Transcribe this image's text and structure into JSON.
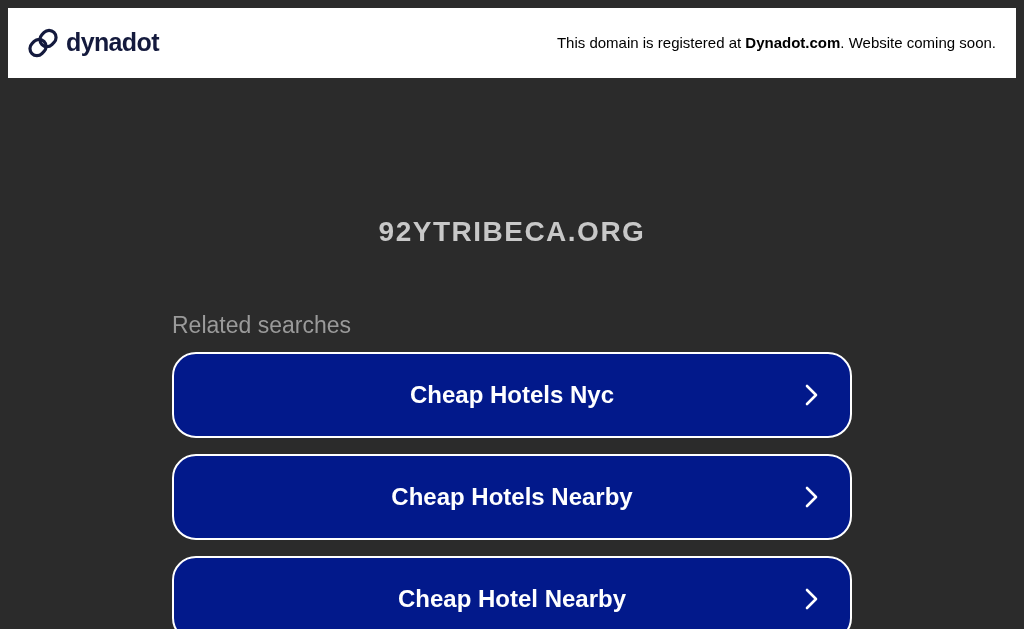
{
  "header": {
    "logo_text": "dynadot",
    "notice": "This domain is registered at **Dynadot.com**. Website coming soon."
  },
  "domain": "92YTRIBECA.ORG",
  "related_searches": {
    "title": "Related searches",
    "items": [
      {
        "label": "Cheap Hotels Nyc"
      },
      {
        "label": "Cheap Hotels Nearby"
      },
      {
        "label": "Cheap Hotel Nearby"
      }
    ]
  }
}
